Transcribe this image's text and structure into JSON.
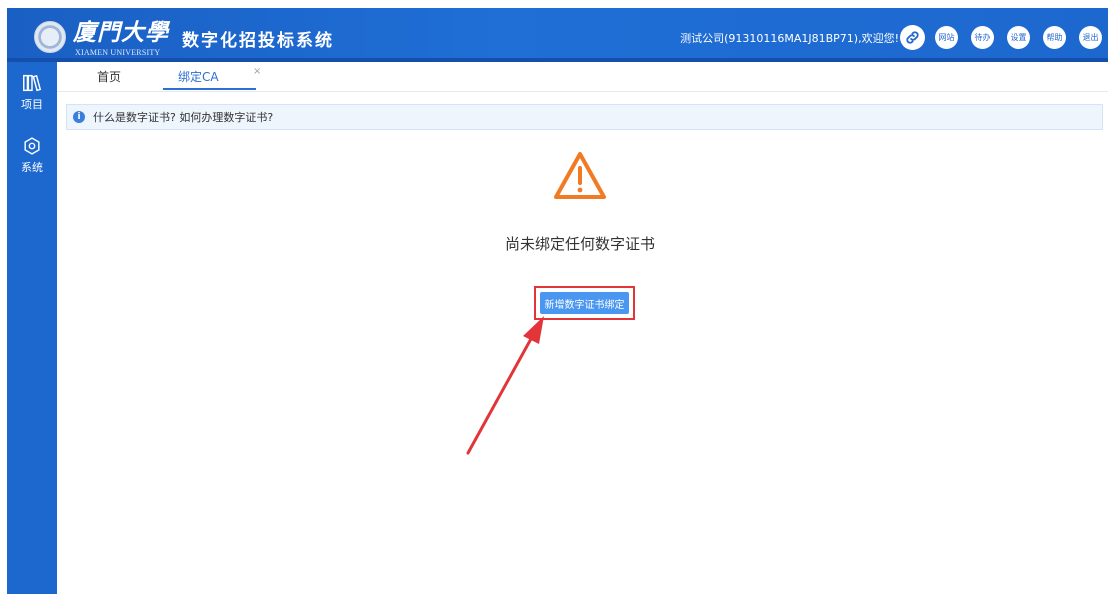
{
  "header": {
    "logo_cn": "廈門大學",
    "logo_en": "XIAMEN UNIVERSITY",
    "system_title": "数字化招投标系统",
    "welcome": "测试公司(91310116MA1J81BP71),欢迎您!",
    "buttons": {
      "site": "网站",
      "todo": "待办",
      "settings": "设置",
      "help": "帮助",
      "exit": "退出"
    },
    "colors": {
      "primary": "#1d68cf",
      "button_bg": "#ffffff"
    }
  },
  "sidebar": {
    "items": [
      {
        "label": "项目",
        "icon": "books-icon"
      },
      {
        "label": "系统",
        "icon": "gear-icon"
      }
    ]
  },
  "tabs": {
    "items": [
      {
        "label": "首页"
      },
      {
        "label": "绑定CA",
        "active": true
      }
    ],
    "close_glyph": "×"
  },
  "info": {
    "text": "什么是数字证书? 如何办理数字证书?",
    "icon": "info-icon"
  },
  "main": {
    "warning_icon": "warning-triangle-icon",
    "warning_color": "#f07b24",
    "empty_text": "尚未绑定任何数字证书",
    "add_button": "新增数字证书绑定",
    "button_color": "#4a97f2",
    "annotation_color": "#e2353a"
  }
}
